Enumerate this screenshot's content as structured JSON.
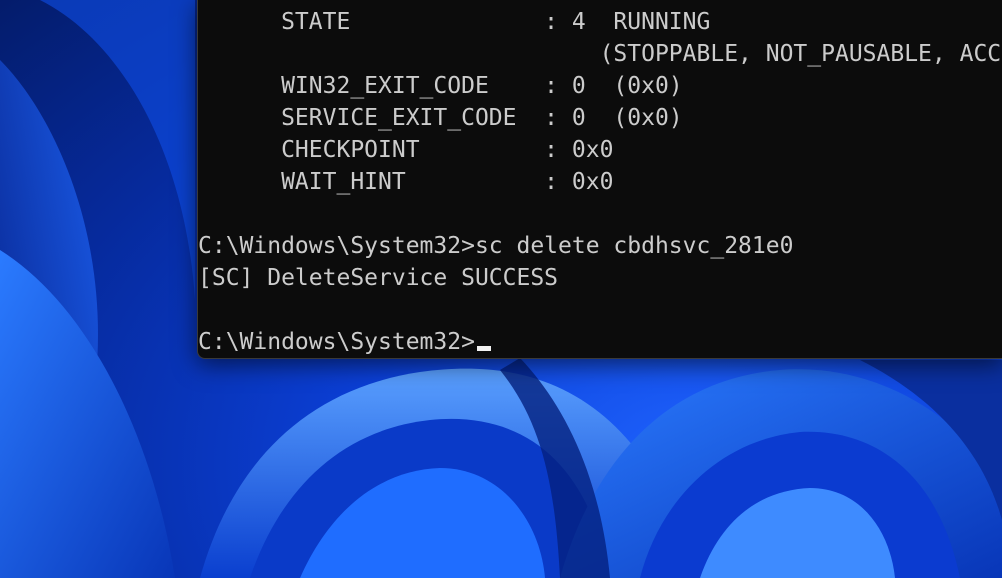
{
  "terminal": {
    "lines": [
      "      STATE              : 4  RUNNING",
      "                             (STOPPABLE, NOT_PAUSABLE, ACCEPTS_SHUTDOWN)",
      "      WIN32_EXIT_CODE    : 0  (0x0)",
      "      SERVICE_EXIT_CODE  : 0  (0x0)",
      "      CHECKPOINT         : 0x0",
      "      WAIT_HINT          : 0x0",
      "",
      "C:\\Windows\\System32>sc delete cbdhsvc_281e0",
      "[SC] DeleteService SUCCESS",
      "",
      "C:\\Windows\\System32>"
    ]
  },
  "colors": {
    "terminal_bg": "#0c0c0c",
    "terminal_text": "#cccccc",
    "wallpaper_blue": "#0b3fd6"
  }
}
